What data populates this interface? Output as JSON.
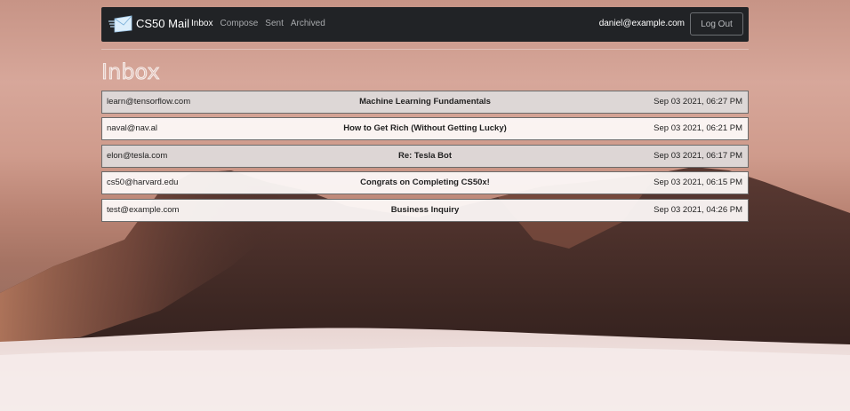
{
  "navbar": {
    "brand": "CS50 Mail",
    "links": [
      {
        "label": "Inbox",
        "active": true
      },
      {
        "label": "Compose",
        "active": false
      },
      {
        "label": "Sent",
        "active": false
      },
      {
        "label": "Archived",
        "active": false
      }
    ],
    "user_email": "daniel@example.com",
    "logout_label": "Log Out"
  },
  "page": {
    "title": "Inbox"
  },
  "emails": [
    {
      "sender": "learn@tensorflow.com",
      "subject": "Machine Learning Fundamentals",
      "timestamp": "Sep 03 2021, 06:27 PM",
      "read": true
    },
    {
      "sender": "naval@nav.al",
      "subject": "How to Get Rich (Without Getting Lucky)",
      "timestamp": "Sep 03 2021, 06:21 PM",
      "read": false
    },
    {
      "sender": "elon@tesla.com",
      "subject": "Re: Tesla Bot",
      "timestamp": "Sep 03 2021, 06:17 PM",
      "read": true
    },
    {
      "sender": "cs50@harvard.edu",
      "subject": "Congrats on Completing CS50x!",
      "timestamp": "Sep 03 2021, 06:15 PM",
      "read": false
    },
    {
      "sender": "test@example.com",
      "subject": "Business Inquiry",
      "timestamp": "Sep 03 2021, 04:26 PM",
      "read": false
    }
  ],
  "colors": {
    "navbar_bg": "#212326",
    "read_row_bg": "#dedada",
    "unread_row_bg": "#fcf8f7"
  }
}
